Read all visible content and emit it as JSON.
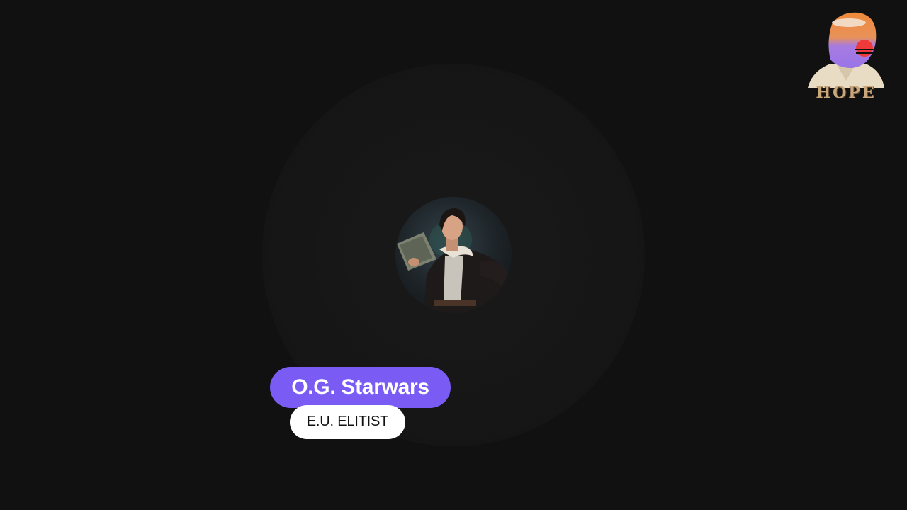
{
  "logo": {
    "text": "HOPE",
    "icon": "hope-portrait-logo"
  },
  "avatar": {
    "icon": "character-portrait"
  },
  "profile": {
    "name": "O.G. Starwars",
    "tag": "E.U. ELITIST"
  },
  "colors": {
    "background": "#111111",
    "name_pill": "#7a5cf5",
    "tag_pill": "#ffffff"
  }
}
